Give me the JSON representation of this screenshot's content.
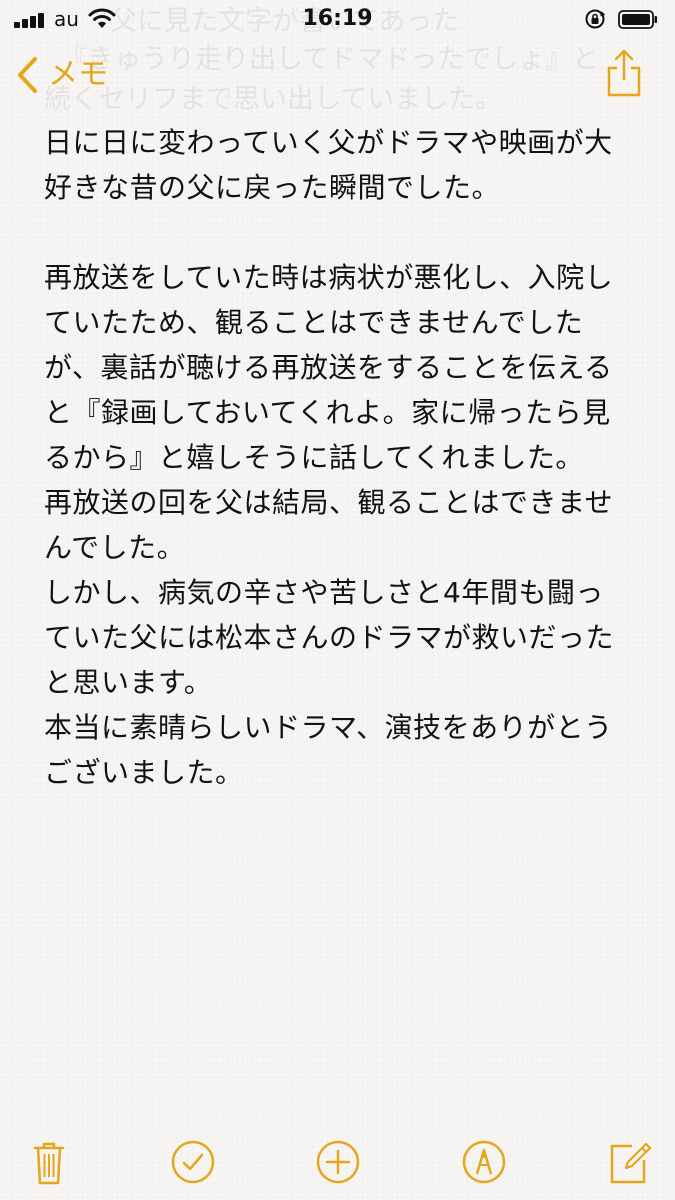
{
  "status_bar": {
    "carrier": "au",
    "time": "16:19"
  },
  "nav": {
    "back_label": "メモ"
  },
  "background_ghost_text": [
    "父に見た文字が書いてあった",
    "『きゅうり走り出してドマドったでしょ』と",
    "続くセリフまで思い出していました。"
  ],
  "note_lines": [
    "日に日に変わっていく父がドラマや映画が大",
    "好きな昔の父に戻った瞬間でした。",
    "",
    "再放送をしていた時は病状が悪化し、入院し",
    "ていたため、観ることはできませんでした",
    "が、裏話が聴ける再放送をすることを伝える",
    "と『録画しておいてくれよ。家に帰ったら見",
    "るから』と嬉しそうに話してくれました。",
    "再放送の回を父は結局、観ることはできませ",
    "んでした。",
    "しかし、病気の辛さや苦しさと4年間も闘っ",
    "ていた父には松本さんのドラマが救いだった",
    "と思います。",
    "本当に素晴らしいドラマ、演技をありがとう",
    "ございました。"
  ],
  "colors": {
    "accent": "#e5a61b",
    "text": "#121212",
    "paper": "#f6f5f3"
  },
  "icons": {
    "signal": "cellular-signal-icon",
    "wifi": "wifi-icon",
    "lock": "rotation-lock-icon",
    "battery": "battery-icon",
    "back": "chevron-left-icon",
    "share": "share-icon",
    "trash": "trash-icon",
    "checklist": "checkmark-circle-icon",
    "add": "plus-circle-icon",
    "markup": "pen-circle-icon",
    "compose": "compose-icon"
  }
}
